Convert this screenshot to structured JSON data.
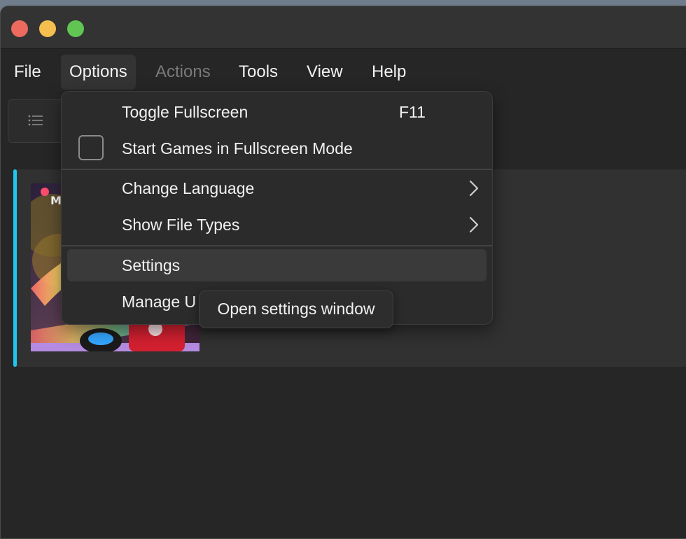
{
  "menubar": {
    "items": [
      {
        "label": "File"
      },
      {
        "label": "Options"
      },
      {
        "label": "Actions"
      },
      {
        "label": "Tools"
      },
      {
        "label": "View"
      },
      {
        "label": "Help"
      }
    ]
  },
  "toolbar": {
    "list_view_icon": "list-icon"
  },
  "options_menu": {
    "items": [
      {
        "label": "Toggle Fullscreen",
        "shortcut": "F11"
      },
      {
        "label": "Start Games in Fullscreen Mode",
        "checked": false
      },
      {
        "label": "Change Language",
        "submenu": true
      },
      {
        "label": "Show File Types",
        "submenu": true
      },
      {
        "label": "Settings",
        "highlighted": true
      },
      {
        "label": "Manage U"
      }
    ]
  },
  "tooltip": {
    "text": "Open settings window"
  },
  "colors": {
    "accent": "#1fc7f0",
    "close": "#ed6a5e",
    "minimize": "#f4bf4f",
    "maximize": "#61c554"
  }
}
